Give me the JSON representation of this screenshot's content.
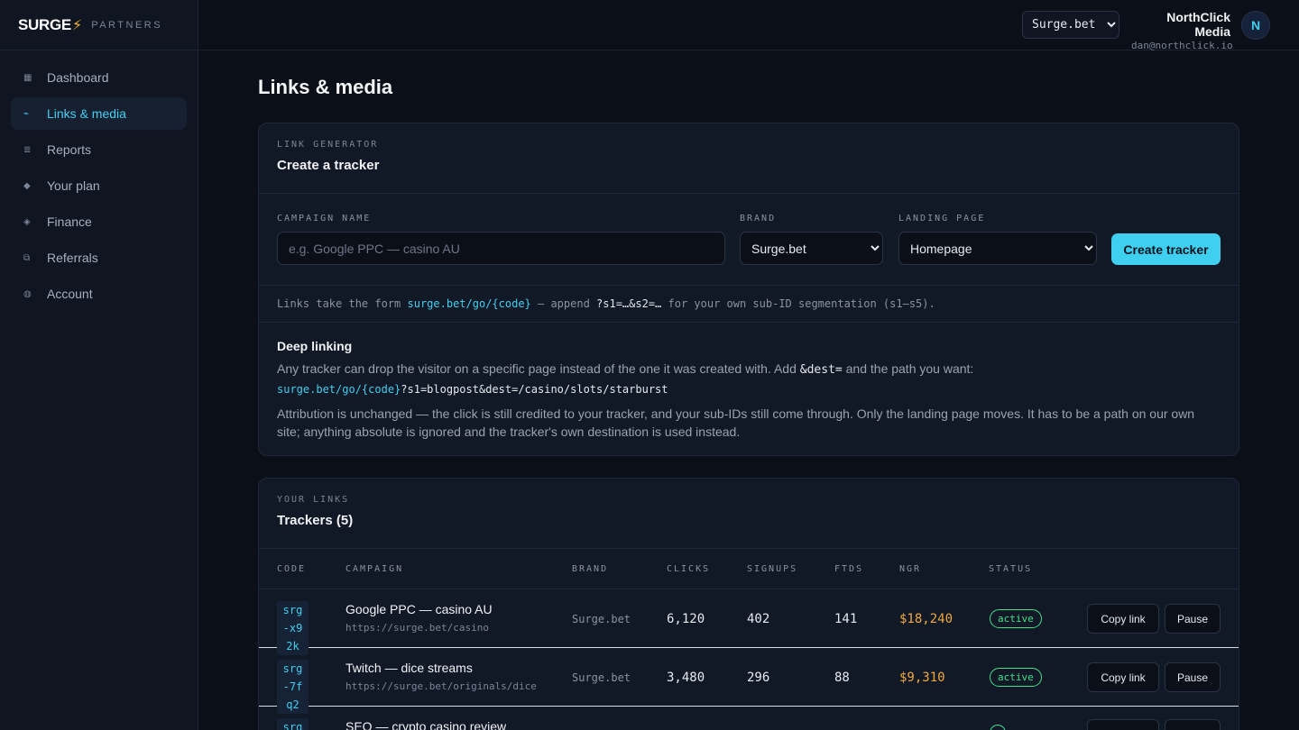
{
  "brand": {
    "logo": "SURGE",
    "bolt": "⚡",
    "sub": "PARTNERS"
  },
  "sidebar": {
    "items": [
      {
        "label": "Dashboard",
        "icon": "▦"
      },
      {
        "label": "Links & media",
        "icon": "⌁"
      },
      {
        "label": "Reports",
        "icon": "≣"
      },
      {
        "label": "Your plan",
        "icon": "◆"
      },
      {
        "label": "Finance",
        "icon": "◈"
      },
      {
        "label": "Referrals",
        "icon": "⧉"
      },
      {
        "label": "Account",
        "icon": "◍"
      }
    ],
    "active_index": 1
  },
  "topbar": {
    "brand_select": {
      "value": "Surge.bet"
    },
    "user_name": "NorthClick Media",
    "user_email": "dan@northclick.io",
    "avatar_initial": "N"
  },
  "page_title": "Links & media",
  "generator": {
    "eyebrow": "LINK GENERATOR",
    "title": "Create a tracker",
    "campaign_label": "CAMPAIGN NAME",
    "campaign_placeholder": "e.g. Google PPC — casino AU",
    "brand_label": "BRAND",
    "brand_value": "Surge.bet",
    "landing_label": "LANDING PAGE",
    "landing_value": "Homepage",
    "create_button": "Create tracker",
    "hint_prefix": "Links take the form ",
    "hint_link": "surge.bet/go/{code}",
    "hint_mid": " — append ",
    "hint_param": "?s1=…&s2=…",
    "hint_suffix": " for your own sub-ID segmentation (s1–s5)."
  },
  "deep_linking": {
    "title": "Deep linking",
    "text_prefix": "Any tracker can drop the visitor on a specific page instead of the one it was created with. Add ",
    "text_code": "&dest=",
    "text_suffix": " and the path you want:",
    "example_base": "surge.bet/go/{code}",
    "example_query": "?s1=blogpost&dest=/casino/slots/starburst",
    "text2": "Attribution is unchanged — the click is still credited to your tracker, and your sub-IDs still come through. Only the landing page moves. It has to be a path on our own site; anything absolute is ignored and the tracker's own destination is used instead."
  },
  "trackers": {
    "eyebrow": "YOUR LINKS",
    "title": "Trackers (5)",
    "columns": [
      "CODE",
      "CAMPAIGN",
      "BRAND",
      "CLICKS",
      "SIGNUPS",
      "FTDS",
      "NGR",
      "STATUS"
    ],
    "rows": [
      {
        "code": "srg-x92k",
        "campaign": "Google PPC — casino AU",
        "url": "https://surge.bet/casino",
        "brand": "Surge.bet",
        "clicks": "6,120",
        "signups": "402",
        "ftds": "141",
        "ngr": "$18,240",
        "status": "active",
        "copy": "Copy link",
        "pause": "Pause"
      },
      {
        "code": "srg-7fq2",
        "campaign": "Twitch — dice streams",
        "url": "https://surge.bet/originals/dice",
        "brand": "Surge.bet",
        "clicks": "3,480",
        "signups": "296",
        "ftds": "88",
        "ngr": "$9,310",
        "status": "active",
        "copy": "Copy link",
        "pause": "Pause"
      },
      {
        "code": "srg-",
        "campaign": "SEO — crypto casino review",
        "url": "",
        "brand": "",
        "clicks": "",
        "signups": "",
        "ftds": "",
        "ngr": "",
        "status": "",
        "copy": "",
        "pause": ""
      }
    ]
  },
  "colors": {
    "accent": "#3fd0f0",
    "ngr": "#f0a93b",
    "active": "#3fe08a",
    "bolt": "#f5b638"
  }
}
